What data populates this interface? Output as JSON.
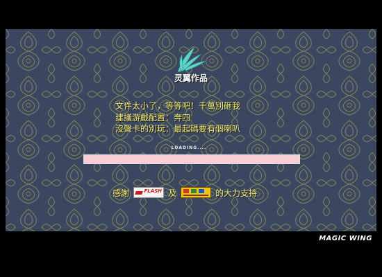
{
  "studio": {
    "name": "灵翼作品"
  },
  "message": {
    "line1": "文件太小了，等等吧！千萬別砸我",
    "line2": "建議游戲配置：奔四",
    "line3": "沒聲卡的別玩：最起碼要有個喇叭"
  },
  "loading": {
    "label": "LOADING....",
    "progress_fraction": 1.0
  },
  "thanks": {
    "prefix": "感謝",
    "conjunction": "及",
    "suffix": "的大力支持",
    "flash_badge_text": "FLASH"
  },
  "brand": {
    "text": "MAGIC WING"
  },
  "colors": {
    "background": "#3b4760",
    "pattern": "#8a8a55",
    "text": "#f2ec6a",
    "progress": "#f8cdd4"
  },
  "icons": {
    "logo": "wing-logo-icon"
  }
}
